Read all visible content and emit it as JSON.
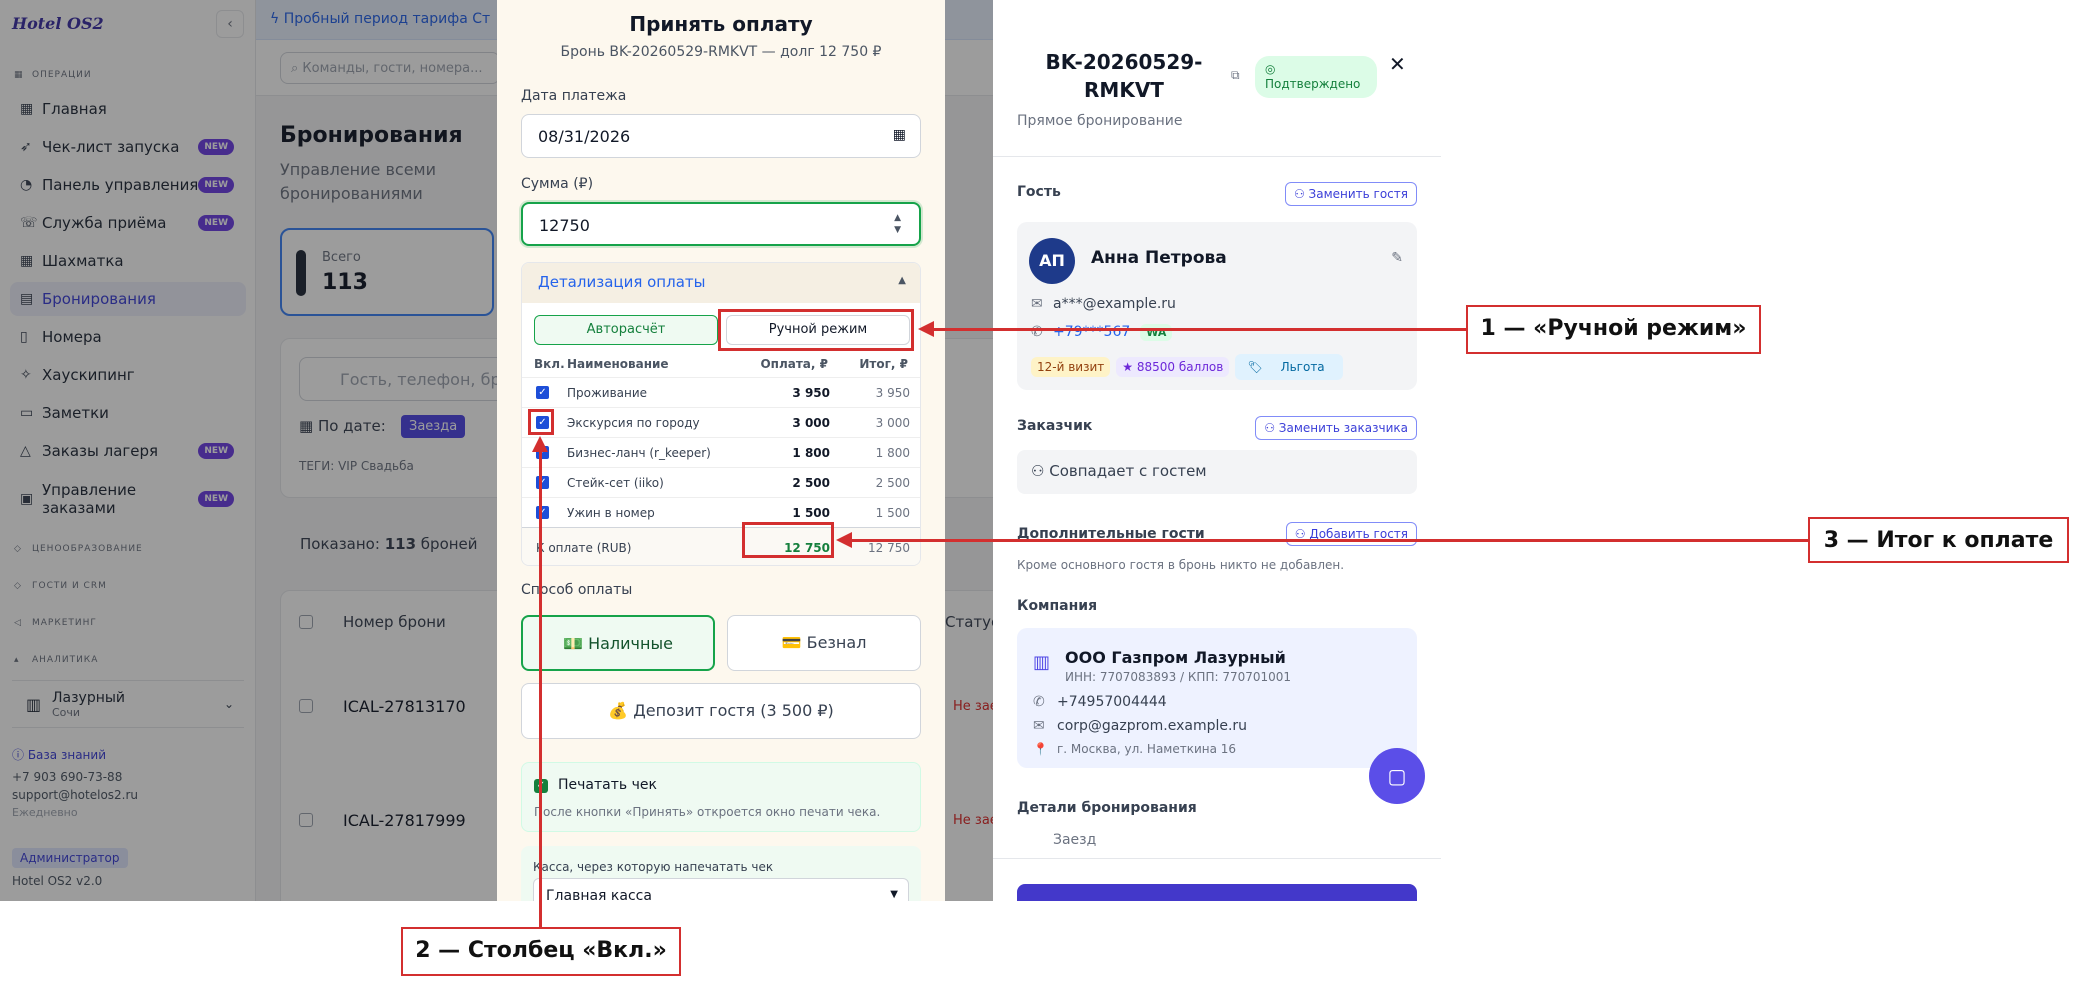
{
  "sidebar": {
    "logo": "Hotel OS2",
    "collapse": "‹",
    "sections": {
      "operations": "ОПЕРАЦИИ",
      "pricing": "ЦЕНООБРАЗОВАНИЕ",
      "guests_crm": "ГОСТИ И CRM",
      "marketing": "МАРКЕТИНГ",
      "analytics": "АНАЛИТИКА"
    },
    "items": [
      {
        "label": "Главная",
        "icon": "grid-icon"
      },
      {
        "label": "Чек-лист запуска",
        "icon": "rocket-icon",
        "badge": "NEW"
      },
      {
        "label": "Панель управления",
        "icon": "dashboard-icon",
        "badge": "NEW"
      },
      {
        "label": "Служба приёма",
        "icon": "reception-icon",
        "badge": "NEW"
      },
      {
        "label": "Шахматка",
        "icon": "calendar-grid-icon"
      },
      {
        "label": "Бронирования",
        "icon": "bookings-icon"
      },
      {
        "label": "Номера",
        "icon": "door-icon"
      },
      {
        "label": "Хаускипинг",
        "icon": "broom-icon"
      },
      {
        "label": "Заметки",
        "icon": "note-icon"
      },
      {
        "label": "Заказы лагеря",
        "icon": "tent-icon",
        "badge": "NEW"
      },
      {
        "label": "Управление заказами",
        "icon": "orders-icon",
        "badge": "NEW"
      }
    ],
    "hotel": {
      "name": "Лазурный",
      "city": "Сочи"
    },
    "footer": {
      "kb": "База знаний",
      "phone": "+7 903 690-73-88",
      "email": "support@hotelos2.ru",
      "hours": "Ежедневно",
      "role": "Администратор",
      "version": "Hotel OS2 v2.0"
    }
  },
  "main": {
    "trial_banner": "Пробный период тарифа Ст",
    "command_placeholder": "Команды, гости, номера...",
    "title": "Бронирования",
    "subtitle": "Управление всеми бронированиями",
    "stat": {
      "label": "Всего",
      "value": "113"
    },
    "search_placeholder": "Гость, телефон, бро",
    "date_filter_label": "По дате:",
    "date_filter_active": "Заезда",
    "tags_label": "ТЕГИ:",
    "tag_vip": "VIP",
    "tag_wedding": "Свадьба",
    "shown_prefix": "Показано:",
    "shown_count": "113",
    "shown_suffix": "броней",
    "table_header_booking": "Номер брони",
    "table_header_status": "Статус",
    "rows": [
      {
        "id": "ICAL-27813170",
        "status": "Не заe"
      },
      {
        "id": "ICAL-27817999",
        "status": "Не заe"
      }
    ]
  },
  "modal": {
    "title": "Принять оплату",
    "subtitle": "Бронь BK-20260529-RMKVT — долг 12 750 ₽",
    "date_label": "Дата платежа",
    "date_value": "08/31/2026",
    "amount_label": "Сумма (₽)",
    "amount_value": "12750",
    "breakdown_title": "Детализация оплаты",
    "mode_auto": "Авторасчёт",
    "mode_manual": "Ручной режим",
    "col_on": "Вкл.",
    "col_name": "Наименование",
    "col_pay": "Оплата, ₽",
    "col_total": "Итог, ₽",
    "items": [
      {
        "name": "Проживание",
        "pay": "3 950",
        "total": "3 950"
      },
      {
        "name": "Экскурсия по городу",
        "pay": "3 000",
        "total": "3 000"
      },
      {
        "name": "Бизнес-ланч (r_keeper)",
        "pay": "1 800",
        "total": "1 800"
      },
      {
        "name": "Стейк-сет (iiko)",
        "pay": "2 500",
        "total": "2 500"
      },
      {
        "name": "Ужин в номер",
        "pay": "1 500",
        "total": "1 500"
      }
    ],
    "total_label": "К оплате (RUB)",
    "total_pay": "12 750",
    "total_total": "12 750",
    "method_label": "Способ оплаты",
    "method_cash": "Наличные",
    "method_card": "Безнал",
    "deposit": "Депозит гостя (3 500 ₽)",
    "print_label": "Печатать чек",
    "print_hint": "После кнопки «Принять» откроется окно печати чека.",
    "kassa_label": "Касса, через которую напечатать чек",
    "kassa_value": "Главная касса"
  },
  "drawer": {
    "booking_id": "BK-20260529-RMKVT",
    "status": "Подтверждено",
    "source": "Прямое бронирование",
    "guest_heading": "Гость",
    "replace_guest": "Заменить гостя",
    "guest": {
      "initials": "АП",
      "name": "Анна Петрова",
      "email": "a***@example.ru",
      "phone": "+79***567",
      "wa": "WA",
      "visits": "12-й визит",
      "points": "★ 88500 баллов",
      "benefit": "Льгота"
    },
    "customer_heading": "Заказчик",
    "replace_customer": "Заменить заказчика",
    "same_as_guest": "Совпадает с гостем",
    "extra_guests_heading": "Дополнительные гости",
    "add_guest": "Добавить гостя",
    "no_extra": "Кроме основного гостя в бронь никто не добавлен.",
    "company_heading": "Компания",
    "company": {
      "name": "ООО Газпром Лазурный",
      "inn": "ИНН: 7707083893 / КПП: 770701001",
      "phone": "+74957004444",
      "email": "corp@gazprom.example.ru",
      "address": "г. Москва, ул. Наметкина 16"
    },
    "details_heading": "Детали бронирования",
    "checkin_label": "Заезд"
  },
  "annotations": {
    "a1": "1 — «Ручной режим»",
    "a2": "2 — Столбец «Вкл.»",
    "a3": "3 — Итог к оплате",
    "color": "#d32f2f"
  }
}
